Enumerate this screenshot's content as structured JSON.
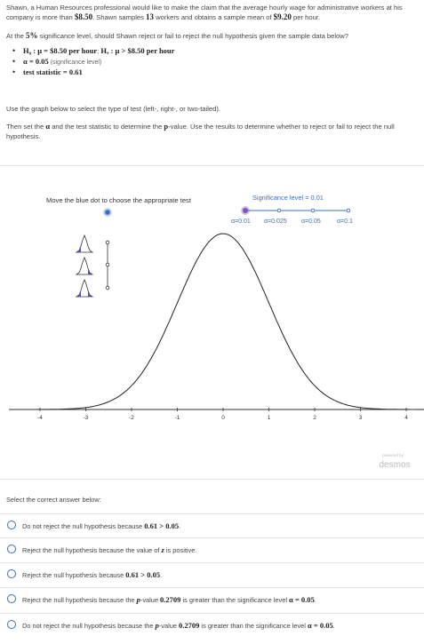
{
  "problem": {
    "intro_a": "Shawn, a Human Resources professional would like to make the claim that the average hourly wage for administrative workers at his company is more than ",
    "claim_value": "$8.50",
    "intro_b": ". Shawn samples ",
    "sample_size": "13",
    "intro_c": " workers and obtains a sample mean of ",
    "sample_mean": "$9.20",
    "intro_d": " per hour.",
    "question_a": "At the ",
    "significance": "5%",
    "question_b": " significance level, should Shawn reject or fail to reject the null hypothesis given the sample data below?",
    "null_h": "H₀ : μ = $8.50 per hour",
    "sep": "; ",
    "alt_h": "Hₐ : μ > $8.50 per hour",
    "alpha": "α = 0.05",
    "alpha_note": " (significance level)",
    "test_stat": "test statistic = 0.61",
    "instr1": "Use the graph below to select the type of test (left-, right-, or two-tailed).",
    "instr2_a": "Then set the ",
    "instr2_alpha": "α",
    "instr2_b": " and the test statistic to determine the ",
    "instr2_p": "p",
    "instr2_c": "-value. Use the results to determine whether to reject or fail to reject the null hypothesis."
  },
  "graph": {
    "move_label": "Move the blue dot to choose the appropriate test",
    "sig_label": "Significance level = 0.01",
    "alpha_options": [
      "α=0.01",
      "α=0.025",
      "α=0.05",
      "α=0.1"
    ],
    "selected_alpha_index": 0,
    "x_ticks": [
      "-4",
      "-3",
      "-2",
      "-1",
      "0",
      "1",
      "2",
      "3",
      "4"
    ],
    "powered_by": "powered by",
    "brand": "desmos",
    "colors": {
      "accent": "#3a70b5",
      "slider": "#7e57c2",
      "curve": "#222222"
    }
  },
  "answers": {
    "prompt": "Select the correct answer below:",
    "options": [
      {
        "pre": "Do not reject the null hypothesis because ",
        "m1": "0.61 > 0.05",
        "post": "."
      },
      {
        "pre": "Reject the null hypothesis because the value of ",
        "m1": "z",
        "post": " is positive."
      },
      {
        "pre": "Reject the null hypothesis because ",
        "m1": "0.61 > 0.05",
        "post": "."
      },
      {
        "pre": "Reject the null hypothesis because the ",
        "m1": "p",
        "mid": "-value ",
        "m2": "0.2709",
        "mid2": " is greater than the significance level ",
        "m3": "α = 0.05",
        "post": "."
      },
      {
        "pre": "Do not reject the null hypothesis because the ",
        "m1": "p",
        "mid": "-value ",
        "m2": "0.2709",
        "mid2": " is greater than the significance level ",
        "m3": "α = 0.05",
        "post": "."
      }
    ]
  }
}
